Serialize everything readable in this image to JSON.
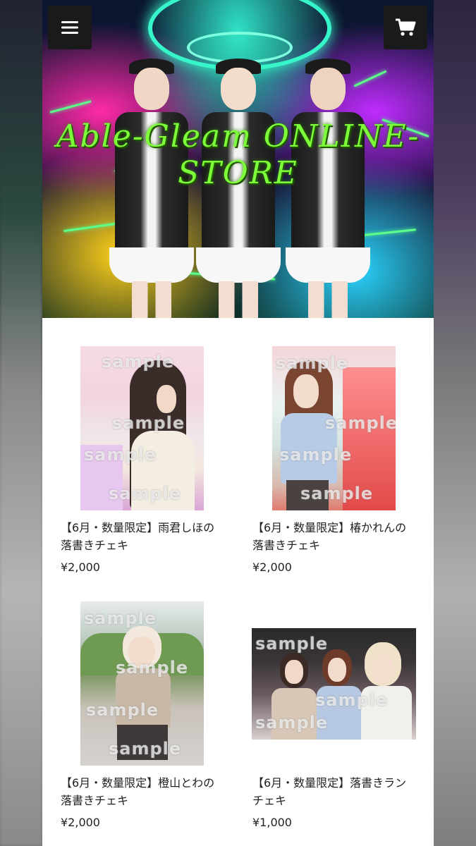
{
  "store": {
    "title_line1": "Able-Gleam ONLINE-",
    "title_line2": "STORE"
  },
  "header": {
    "menu_icon": "hamburger-menu-icon",
    "cart_icon": "shopping-cart-icon"
  },
  "watermark": "sample",
  "products": [
    {
      "title_line1": "【6月・数量限定】雨君しほの",
      "title_line2": "落書きチェキ",
      "price": "¥2,000"
    },
    {
      "title_line1": "【6月・数量限定】椿かれんの",
      "title_line2": "落書きチェキ",
      "price": "¥2,000"
    },
    {
      "title_line1": "【6月・数量限定】橙山とわの",
      "title_line2": "落書きチェキ",
      "price": "¥2,000"
    },
    {
      "title_line1": "【6月・数量限定】落書きラン",
      "title_line2": "チェキ",
      "price": "¥1,000"
    }
  ],
  "colors": {
    "title_green": "#7dff3a",
    "header_button_bg": "#1a1a1a",
    "page_bg": "#ffffff"
  }
}
